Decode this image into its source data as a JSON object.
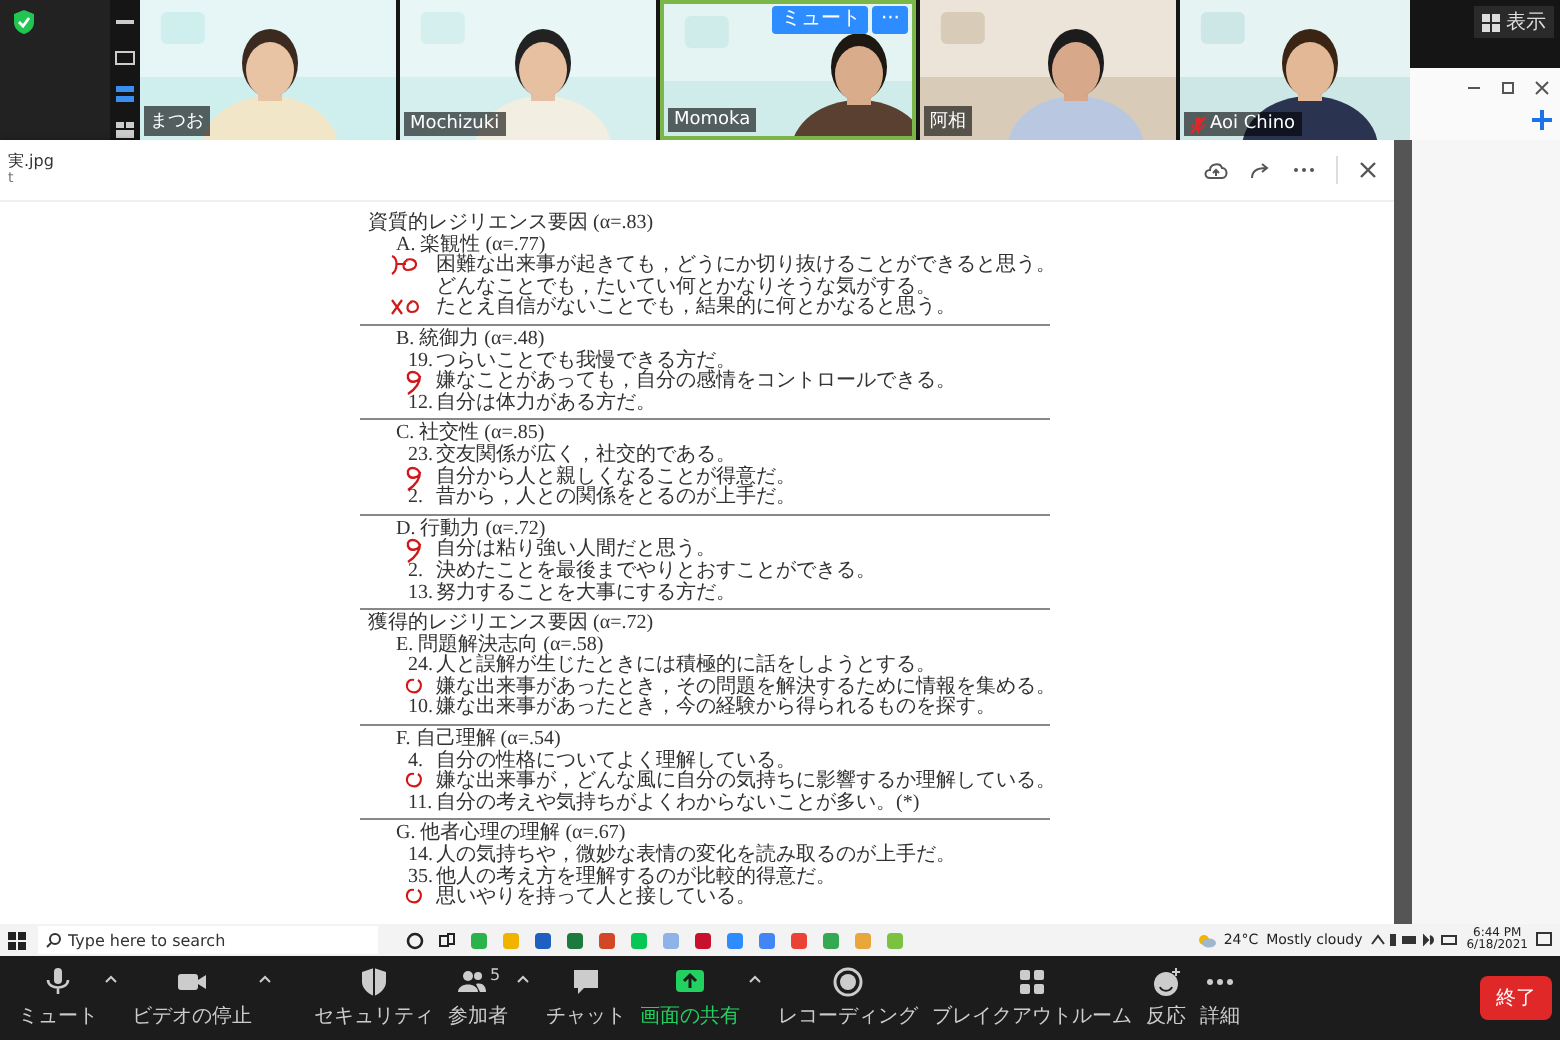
{
  "view_button": "表示",
  "participants": [
    {
      "name": "まつお",
      "muted": false,
      "speaking": false
    },
    {
      "name": "Mochizuki",
      "muted": false,
      "speaking": false
    },
    {
      "name": "Momoka",
      "muted": false,
      "speaking": true,
      "hover_buttons": [
        "ミュート",
        "···"
      ]
    },
    {
      "name": "阿相",
      "muted": false,
      "speaking": false
    },
    {
      "name": "Aoi Chino",
      "muted": true,
      "speaking": false
    }
  ],
  "viewer": {
    "file_name": "実.jpg",
    "subtitle": "t"
  },
  "document": {
    "sections": [
      {
        "title": "資質的レジリエンス要因 (α=.83)",
        "groups": [
          {
            "heading": "A. 楽観性 (α=.77)",
            "items": [
              {
                "text": "困難な出来事が起きても，どうにか切り抜けることができると思う。",
                "kind": "arrow-loop"
              },
              {
                "text": "どんなことでも，たいてい何とかなりそうな気がする。",
                "kind": "plain"
              },
              {
                "text": "たとえ自信がないことでも，結果的に何とかなると思う。",
                "kind": "cross-loop"
              }
            ]
          },
          {
            "heading": "B. 統御力 (α=.48)",
            "items": [
              {
                "number": "19.",
                "text": "つらいことでも我慢できる方だ。",
                "kind": "plain"
              },
              {
                "text": "嫌なことがあっても，自分の感情をコントロールできる。",
                "kind": "loop"
              },
              {
                "number": "12.",
                "text": "自分は体力がある方だ。",
                "kind": "plain"
              }
            ]
          },
          {
            "heading": "C. 社交性 (α=.85)",
            "items": [
              {
                "number": "23.",
                "text": "交友関係が広く，社交的である。",
                "kind": "plain"
              },
              {
                "text": "自分から人と親しくなることが得意だ。",
                "kind": "loop"
              },
              {
                "number": "2.",
                "text": "昔から，人との関係をとるのが上手だ。",
                "kind": "plain"
              }
            ]
          },
          {
            "heading": "D. 行動力 (α=.72)",
            "items": [
              {
                "text": "自分は粘り強い人間だと思う。",
                "kind": "loop"
              },
              {
                "number": "2.",
                "text": "決めたことを最後までやりとおすことができる。",
                "kind": "plain"
              },
              {
                "number": "13.",
                "text": "努力することを大事にする方だ。",
                "kind": "plain"
              }
            ]
          }
        ]
      },
      {
        "title": "獲得的レジリエンス要因 (α=.72)",
        "groups": [
          {
            "heading": "E. 問題解決志向 (α=.58)",
            "items": [
              {
                "number": "24.",
                "text": "人と誤解が生じたときには積極的に話をしようとする。",
                "kind": "plain"
              },
              {
                "text": "嫌な出来事があったとき，その問題を解決するために情報を集める。",
                "kind": "circle"
              },
              {
                "number": "10.",
                "text": "嫌な出来事があったとき，今の経験から得られるものを探す。",
                "kind": "plain"
              }
            ]
          },
          {
            "heading": "F. 自己理解 (α=.54)",
            "items": [
              {
                "number": "4.",
                "text": "自分の性格についてよく理解している。",
                "kind": "plain"
              },
              {
                "text": "嫌な出来事が，どんな風に自分の気持ちに影響するか理解している。",
                "kind": "circle"
              },
              {
                "number": "11.",
                "text": "自分の考えや気持ちがよくわからないことが多い。(*)",
                "kind": "plain"
              }
            ]
          },
          {
            "heading": "G. 他者心理の理解 (α=.67)",
            "items": [
              {
                "number": "14.",
                "text": "人の気持ちや，微妙な表情の変化を読み取るのが上手だ。",
                "kind": "plain"
              },
              {
                "number": "35.",
                "text": "他人の考え方を理解するのが比較的得意だ。",
                "kind": "plain"
              },
              {
                "text": "思いやりを持って人と接している。",
                "kind": "circle"
              }
            ]
          }
        ]
      }
    ]
  },
  "taskbar": {
    "search_placeholder": "Type here to search",
    "temperature": "24°C",
    "weather": "Mostly cloudy",
    "time": "6:44 PM",
    "date": "6/18/2021"
  },
  "toolbar": {
    "items": [
      {
        "label": "ミュート",
        "kind": "mic",
        "caret": true
      },
      {
        "label": "ビデオの停止",
        "kind": "video",
        "caret": true
      },
      {
        "label": "セキュリティ",
        "kind": "shield",
        "caret": false
      },
      {
        "label": "参加者",
        "kind": "people",
        "caret": true,
        "count": "5"
      },
      {
        "label": "チャット",
        "kind": "chat",
        "caret": false
      },
      {
        "label": "画面の共有",
        "kind": "share",
        "caret": true
      },
      {
        "label": "レコーディング",
        "kind": "record",
        "caret": false
      },
      {
        "label": "ブレイクアウトルーム",
        "kind": "grid",
        "caret": false
      },
      {
        "label": "反応",
        "kind": "smile",
        "caret": false
      },
      {
        "label": "詳細",
        "kind": "dots",
        "caret": false
      }
    ],
    "end_button": "終了"
  }
}
